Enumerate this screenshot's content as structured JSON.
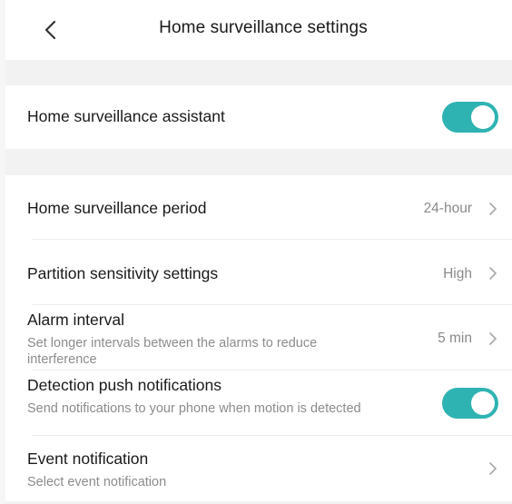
{
  "header": {
    "title": "Home surveillance settings"
  },
  "assistant": {
    "label": "Home surveillance assistant",
    "enabled": true
  },
  "period": {
    "label": "Home surveillance period",
    "value": "24-hour"
  },
  "sensitivity": {
    "label": "Partition sensitivity settings",
    "value": "High"
  },
  "alarm_interval": {
    "label": "Alarm interval",
    "description": "Set longer intervals between the alarms to reduce interference",
    "value": "5 min"
  },
  "push_notifications": {
    "label": "Detection push notifications",
    "description": "Send notifications to your phone when motion is detected",
    "enabled": true
  },
  "event_notification": {
    "label": "Event notification",
    "description": "Select event notification"
  },
  "colors": {
    "toggle_on": "#2fb3b2",
    "background": "#f2f2f2",
    "surface": "#ffffff"
  },
  "icons": {
    "back": "chevron-left-icon",
    "row_arrow": "chevron-right-icon"
  }
}
